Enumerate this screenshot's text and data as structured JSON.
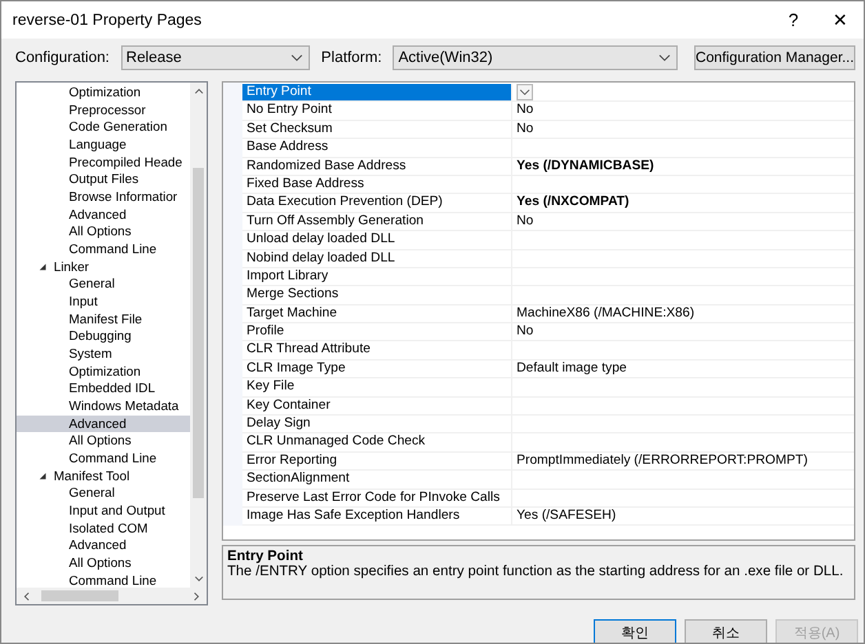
{
  "window": {
    "title": "reverse-01 Property Pages",
    "help": "?",
    "close": "✕"
  },
  "toolbar": {
    "configuration_label": "Configuration:",
    "configuration": "Release",
    "platform_label": "Platform:",
    "platform": "Active(Win32)",
    "manager_button": "Configuration Manager..."
  },
  "tree": [
    {
      "kind": "hidden",
      "children": [
        {
          "label": "Optimization",
          "selected": false
        },
        {
          "label": "Preprocessor",
          "selected": false
        },
        {
          "label": "Code Generation",
          "selected": false
        },
        {
          "label": "Language",
          "selected": false
        },
        {
          "label": "Precompiled Heade",
          "selected": false
        },
        {
          "label": "Output Files",
          "selected": false
        },
        {
          "label": "Browse Informatior",
          "selected": false
        },
        {
          "label": "Advanced",
          "selected": false
        },
        {
          "label": "All Options",
          "selected": false
        },
        {
          "label": "Command Line",
          "selected": false
        }
      ]
    },
    {
      "kind": "node",
      "label": "Linker",
      "expanded": true,
      "selected": false,
      "children": [
        {
          "label": "General",
          "selected": false
        },
        {
          "label": "Input",
          "selected": false
        },
        {
          "label": "Manifest File",
          "selected": false
        },
        {
          "label": "Debugging",
          "selected": false
        },
        {
          "label": "System",
          "selected": false
        },
        {
          "label": "Optimization",
          "selected": false
        },
        {
          "label": "Embedded IDL",
          "selected": false
        },
        {
          "label": "Windows Metadata",
          "selected": false
        },
        {
          "label": "Advanced",
          "selected": true
        },
        {
          "label": "All Options",
          "selected": false
        },
        {
          "label": "Command Line",
          "selected": false
        }
      ]
    },
    {
      "kind": "node",
      "label": "Manifest Tool",
      "expanded": true,
      "selected": false,
      "children": [
        {
          "label": "General",
          "selected": false
        },
        {
          "label": "Input and Output",
          "selected": false
        },
        {
          "label": "Isolated COM",
          "selected": false
        },
        {
          "label": "Advanced",
          "selected": false
        },
        {
          "label": "All Options",
          "selected": false
        },
        {
          "label": "Command Line",
          "selected": false
        }
      ]
    }
  ],
  "properties": [
    {
      "name": "Entry Point",
      "selected": true
    },
    {
      "name": "No Entry Point",
      "value": "No",
      "selected": false,
      "modified": false
    },
    {
      "name": "Set Checksum",
      "value": "No",
      "selected": false,
      "modified": false
    },
    {
      "name": "Base Address",
      "selected": false
    },
    {
      "name": "Randomized Base Address",
      "value": "Yes (/DYNAMICBASE)",
      "selected": false,
      "modified": true
    },
    {
      "name": "Fixed Base Address",
      "selected": false
    },
    {
      "name": "Data Execution Prevention (DEP)",
      "value": "Yes (/NXCOMPAT)",
      "selected": false,
      "modified": true
    },
    {
      "name": "Turn Off Assembly Generation",
      "value": "No",
      "selected": false,
      "modified": false
    },
    {
      "name": "Unload delay loaded DLL",
      "selected": false
    },
    {
      "name": "Nobind delay loaded DLL",
      "selected": false
    },
    {
      "name": "Import Library",
      "selected": false
    },
    {
      "name": "Merge Sections",
      "selected": false
    },
    {
      "name": "Target Machine",
      "value": "MachineX86 (/MACHINE:X86)",
      "selected": false,
      "modified": false
    },
    {
      "name": "Profile",
      "value": "No",
      "selected": false,
      "modified": false
    },
    {
      "name": "CLR Thread Attribute",
      "selected": false
    },
    {
      "name": "CLR Image Type",
      "value": "Default image type",
      "selected": false,
      "modified": false
    },
    {
      "name": "Key File",
      "selected": false
    },
    {
      "name": "Key Container",
      "selected": false
    },
    {
      "name": "Delay Sign",
      "selected": false
    },
    {
      "name": "CLR Unmanaged Code Check",
      "selected": false
    },
    {
      "name": "Error Reporting",
      "value": "PromptImmediately (/ERRORREPORT:PROMPT)",
      "selected": false,
      "modified": false
    },
    {
      "name": "SectionAlignment",
      "selected": false
    },
    {
      "name": "Preserve Last Error Code for PInvoke Calls",
      "selected": false
    },
    {
      "name": "Image Has Safe Exception Handlers",
      "value": "Yes (/SAFESEH)",
      "selected": false,
      "modified": false
    }
  ],
  "description": {
    "title": "Entry Point",
    "text": "The /ENTRY option specifies an entry point function as the starting address for an .exe file or DLL."
  },
  "buttons": [
    {
      "label": "확인",
      "kind": "default",
      "disabled": false
    },
    {
      "label": "취소",
      "kind": "normal",
      "disabled": false
    },
    {
      "label": "적용(A)",
      "kind": "normal",
      "disabled": true
    }
  ]
}
